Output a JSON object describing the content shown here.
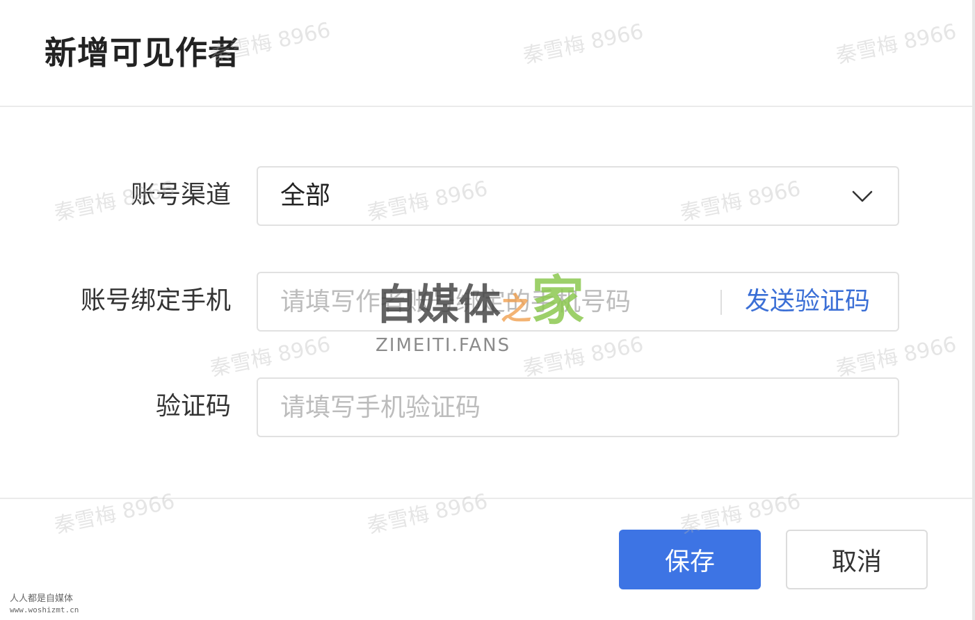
{
  "dialog": {
    "title": "新增可见作者"
  },
  "form": {
    "channel": {
      "label": "账号渠道",
      "value": "全部",
      "icon": "chevron-down-icon"
    },
    "phone": {
      "label": "账号绑定手机",
      "placeholder": "请填写作者账号绑定的手机号码",
      "send_code_label": "发送验证码"
    },
    "code": {
      "label": "验证码",
      "placeholder": "请填写手机验证码"
    }
  },
  "footer": {
    "save_label": "保存",
    "cancel_label": "取消"
  },
  "watermark": {
    "text": "秦雪梅 8966",
    "logo_text": "自媒体",
    "logo_zhi": "之",
    "logo_jia": "家",
    "logo_sub": "ZIMEITI.FANS",
    "corner_line1": "人人都是自媒体",
    "corner_line2": "www.woshizmt.cn"
  },
  "colors": {
    "primary": "#3d74e4",
    "link": "#3b6fd6",
    "border": "#e1e1e1"
  }
}
